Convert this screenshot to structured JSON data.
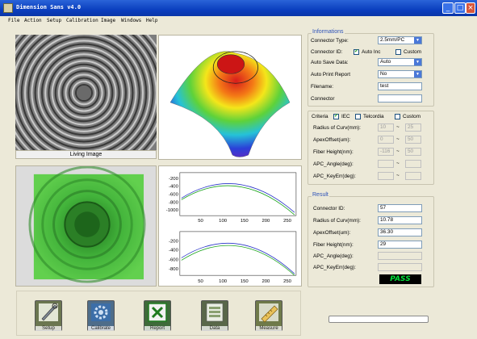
{
  "window": {
    "title": "Dimension Sans v4.0"
  },
  "menu": [
    "File",
    "Action",
    "Setup",
    "Calibration",
    "Image",
    "Windows",
    "Help"
  ],
  "live_image": {
    "caption": "Living Image"
  },
  "informations": {
    "title": "Informations",
    "connector_type_label": "Connector Type:",
    "connector_type_value": "2.5mm/PC",
    "connector_id_label": "Connector ID:",
    "auto_inc_label": "Auto Inc",
    "auto_inc_checked": true,
    "custom_label": "Custom",
    "custom_checked": false,
    "auto_save_label": "Auto Save Data:",
    "auto_save_value": "Auto",
    "auto_print_label": "Auto Print Report",
    "auto_print_value": "No",
    "filename_label": "Filename:",
    "filename_value": "test",
    "connector_label": "Connector",
    "connector_value": ""
  },
  "criteria": {
    "label": "Criteria",
    "iec_label": "IEC",
    "iec_checked": true,
    "telcordia_label": "Telcordia",
    "telcordia_checked": false,
    "custom_label": "Custom",
    "custom_checked": false,
    "rows": [
      {
        "label": "Radius of Curv(mm):",
        "min": "10",
        "max": "25"
      },
      {
        "label": "ApexOffset(um):",
        "min": "0",
        "max": "50"
      },
      {
        "label": "Fiber Height(nm):",
        "min": "-116",
        "max": "50"
      },
      {
        "label": "APC_Angle(deg):",
        "min": "",
        "max": ""
      },
      {
        "label": "APC_KeyErr(deg):",
        "min": "",
        "max": ""
      }
    ]
  },
  "result": {
    "title": "Result",
    "rows": [
      {
        "label": "Connector ID:",
        "value": "57",
        "enabled": true
      },
      {
        "label": "Radius of Curv(mm):",
        "value": "10.78",
        "enabled": true
      },
      {
        "label": "ApexOffset(um):",
        "value": "36.30",
        "enabled": true
      },
      {
        "label": "Fiber Height(nm):",
        "value": "29",
        "enabled": true
      },
      {
        "label": "APC_Angle(deg):",
        "value": "",
        "enabled": false
      },
      {
        "label": "APC_KeyErr(deg):",
        "value": "",
        "enabled": false
      }
    ],
    "status": "PASS",
    "status_color": "#00e13a"
  },
  "profile_plots": [
    {
      "y_ticks": [
        "-200",
        "-400",
        "-600",
        "-800",
        "-1000"
      ],
      "x_ticks": [
        "50",
        "100",
        "150",
        "200",
        "250"
      ]
    },
    {
      "y_ticks": [
        "-200",
        "-400",
        "-600",
        "-800"
      ],
      "x_ticks": [
        "50",
        "100",
        "150",
        "200",
        "250"
      ]
    }
  ],
  "toolbar": {
    "buttons": [
      {
        "label": "Setup",
        "icon": "wrench-icon"
      },
      {
        "label": "Calibrate",
        "icon": "gear-icon"
      },
      {
        "label": "Report",
        "icon": "excel-icon"
      },
      {
        "label": "Data",
        "icon": "data-icon"
      },
      {
        "label": "Measure",
        "icon": "ruler-icon"
      }
    ]
  },
  "progress": {
    "value": 0
  },
  "colors": {
    "accent": "#2d52b8",
    "titlebar": "#0b3fbf"
  }
}
